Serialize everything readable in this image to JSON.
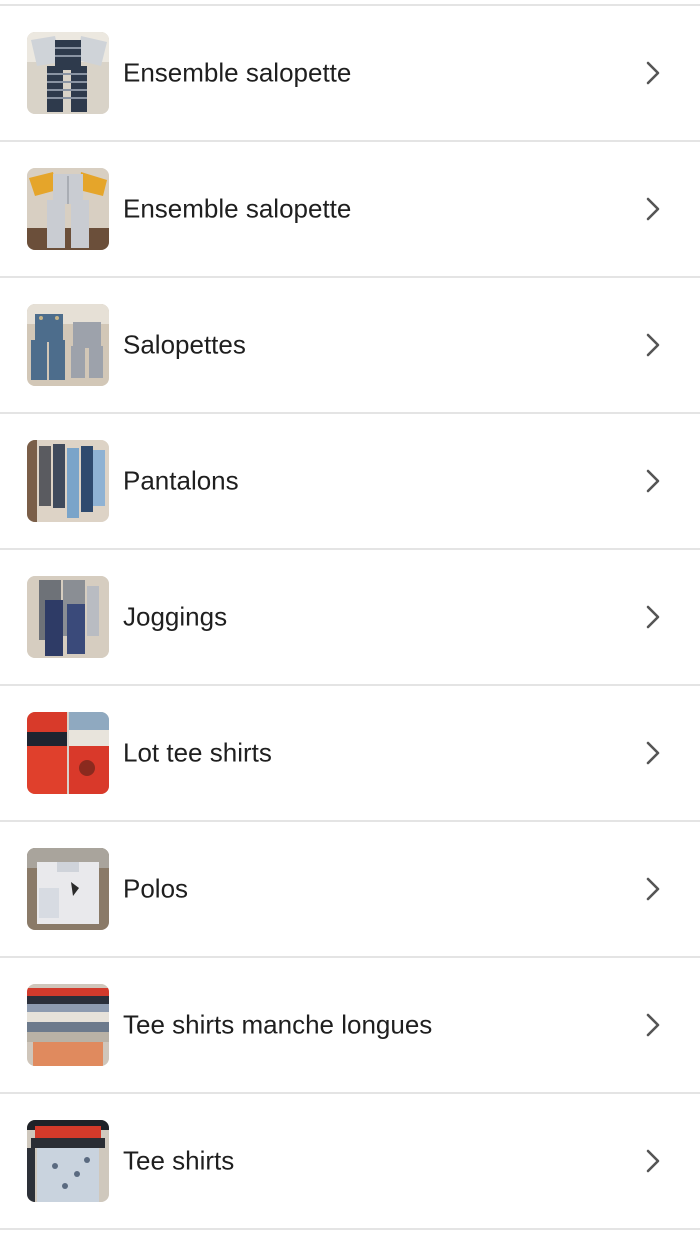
{
  "items": [
    {
      "label": "Ensemble salopette",
      "thumb": "overalls-striped-photo"
    },
    {
      "label": "Ensemble salopette",
      "thumb": "overalls-light-photo"
    },
    {
      "label": "Salopettes",
      "thumb": "denim-overalls-photo"
    },
    {
      "label": "Pantalons",
      "thumb": "pants-photo"
    },
    {
      "label": "Joggings",
      "thumb": "joggings-photo"
    },
    {
      "label": "Lot tee shirts",
      "thumb": "tshirts-red-photo"
    },
    {
      "label": "Polos",
      "thumb": "polos-photo"
    },
    {
      "label": "Tee shirts manche longues",
      "thumb": "longsleeve-photo"
    },
    {
      "label": "Tee shirts",
      "thumb": "tshirts-photo"
    }
  ],
  "icons": {
    "chevron": "chevron-right-icon"
  },
  "colors": {
    "text": "#1f1f1f",
    "divider": "#e4e4e4",
    "chevron": "#555555"
  }
}
